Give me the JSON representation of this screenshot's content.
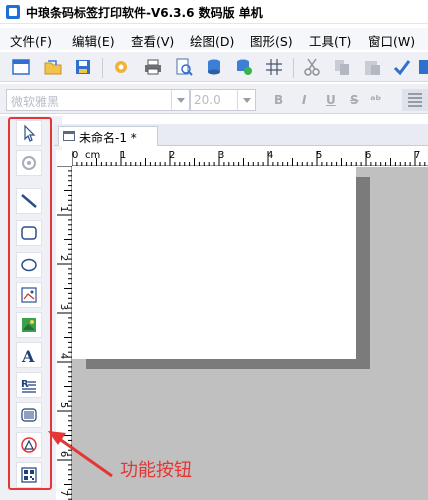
{
  "window": {
    "title": "中琅条码标签打印软件-V6.3.6 数码版 单机"
  },
  "menu": [
    {
      "label": "文件(F)"
    },
    {
      "label": "编辑(E)"
    },
    {
      "label": "查看(V)"
    },
    {
      "label": "绘图(D)"
    },
    {
      "label": "图形(S)"
    },
    {
      "label": "工具(T)"
    },
    {
      "label": "窗口(W)"
    }
  ],
  "format_bar": {
    "font_name": "微软雅黑",
    "font_size": "20.0",
    "bold": "B",
    "italic": "I",
    "underline": "U",
    "strikethrough": "S",
    "superscript": "ᵃᵇ"
  },
  "document": {
    "tab_label": "未命名-1 *"
  },
  "ruler": {
    "unit": "cm",
    "top_labels": [
      "0",
      "1",
      "2",
      "3",
      "4",
      "5",
      "6",
      "7"
    ],
    "left_labels": [
      "1",
      "2",
      "3",
      "4",
      "5",
      "6",
      "7"
    ]
  },
  "annotation": {
    "text": "功能按钮",
    "color": "#e53535"
  },
  "tools": [
    {
      "icon": "select-arrow-icon"
    },
    {
      "icon": "rotate-icon"
    },
    {
      "icon": "line-icon"
    },
    {
      "icon": "rounded-rectangle-icon"
    },
    {
      "icon": "ellipse-icon"
    },
    {
      "icon": "image-icon"
    },
    {
      "icon": "picture-icon"
    },
    {
      "icon": "text-icon"
    },
    {
      "icon": "rich-text-icon"
    },
    {
      "icon": "barcode-icon"
    },
    {
      "icon": "triangle-shape-icon"
    },
    {
      "icon": "qr-code-icon"
    }
  ]
}
